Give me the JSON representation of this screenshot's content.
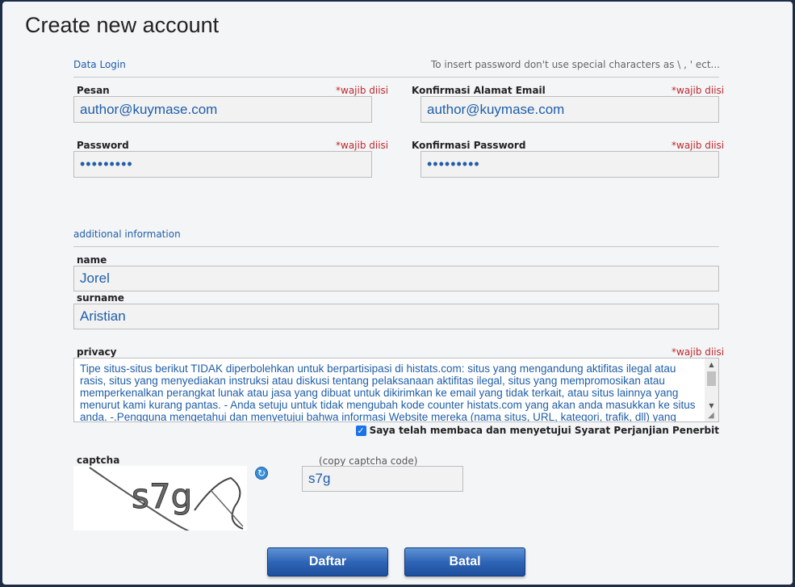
{
  "title": "Create new account",
  "sections": {
    "login": "Data Login",
    "login_hint": "To insert password don't use special characters as \\ , ' ect...",
    "additional": "additional information"
  },
  "required_text": "*wajib diisi",
  "fields": {
    "email": {
      "label": "Pesan",
      "value": "author@kuymase.com"
    },
    "email_confirm": {
      "label": "Konfirmasi Alamat Email",
      "value": "author@kuymase.com"
    },
    "password": {
      "label": "Password",
      "value": "•••••••••"
    },
    "password_confirm": {
      "label": "Konfirmasi Password",
      "value": "•••••••••"
    },
    "name": {
      "label": "name",
      "value": "Jorel"
    },
    "surname": {
      "label": "surname",
      "value": "Aristian"
    }
  },
  "privacy": {
    "label": "privacy",
    "text": "Tipe situs-situs berikut TIDAK diperbolehkan untuk berpartisipasi di histats.com: situs yang mengandung aktifitas ilegal atau rasis, situs yang menyediakan instruksi atau diskusi tentang pelaksanaan aktifitas ilegal, situs yang mempromosikan atau memperkenalkan perangkat lunak atau jasa yang dibuat untuk dikirimkan ke email yang tidak terkait, atau situs lainnya yang menurut kami kurang pantas. - Anda setuju untuk tidak mengubah kode counter histats.com yang akan anda masukkan ke situs anda. -.Pengguna mengetahui dan menyetujui bahwa informasi Website mereka (nama situs, URL, kategori, trafik, dll) yang disediakan oleh histats.com (bagian dari pengguna) dapat dibuat publik."
  },
  "agree": {
    "checked": true,
    "label": "Saya telah membaca dan menyetujui Syarat Perjanjian Penerbit"
  },
  "captcha": {
    "label": "captcha",
    "image_text": "s7g",
    "hint": "(copy captcha code)",
    "value": "s7g"
  },
  "buttons": {
    "submit": "Daftar",
    "cancel": "Batal"
  }
}
